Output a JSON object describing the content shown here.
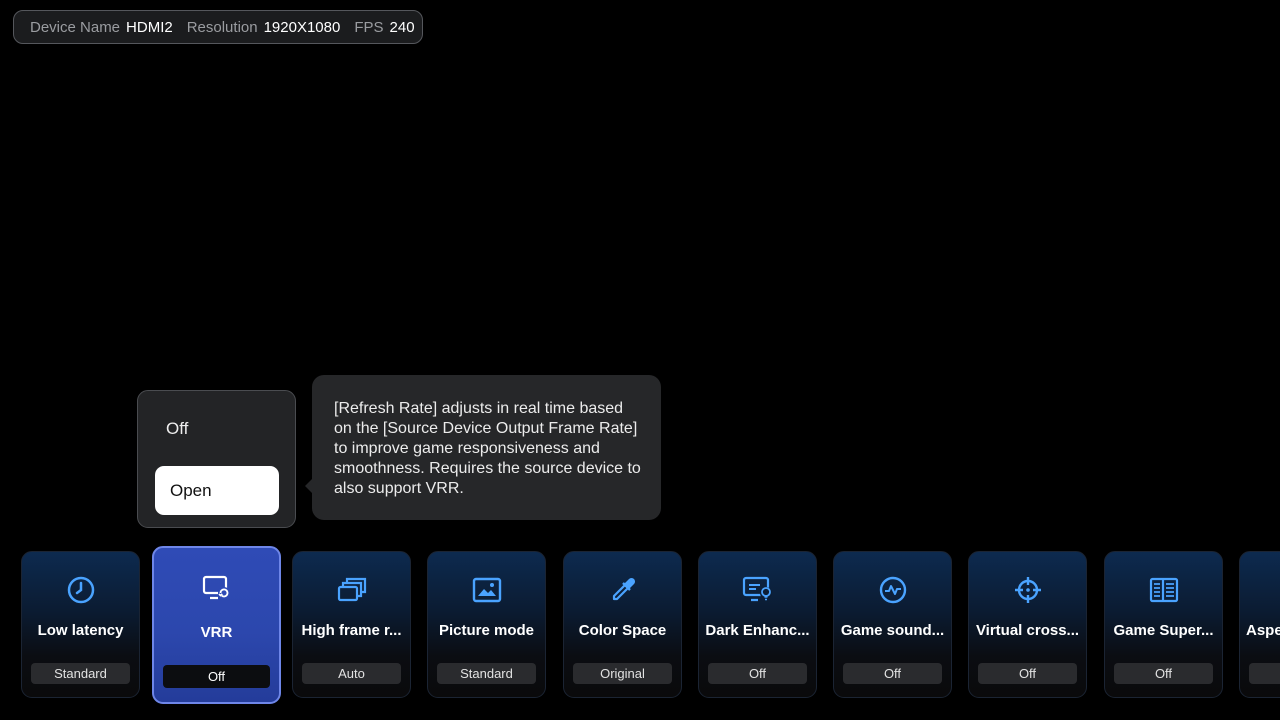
{
  "infobar": {
    "device_name_label": "Device Name",
    "device_name_value": "HDMI2",
    "resolution_label": "Resolution",
    "resolution_value": "1920X1080",
    "fps_label": "FPS",
    "fps_value": "240"
  },
  "dropdown": {
    "options": [
      "Off",
      "Open"
    ],
    "highlighted": "Open"
  },
  "tooltip": {
    "text": "[Refresh Rate] adjusts in real time based on the [Source Device Output Frame Rate] to improve game responsiveness and smoothness. Requires the source device to also support VRR."
  },
  "cards": [
    {
      "title": "Low latency",
      "value": "Standard",
      "icon": "clock-icon"
    },
    {
      "title": "VRR",
      "value": "Off",
      "icon": "monitor-refresh-icon",
      "selected": true
    },
    {
      "title": "High frame r...",
      "value": "Auto",
      "icon": "stacked-frames-icon"
    },
    {
      "title": "Picture mode",
      "value": "Standard",
      "icon": "picture-icon"
    },
    {
      "title": "Color Space",
      "value": "Original",
      "icon": "eyedropper-icon"
    },
    {
      "title": "Dark Enhanc...",
      "value": "Off",
      "icon": "monitor-bulb-icon"
    },
    {
      "title": "Game sound...",
      "value": "Off",
      "icon": "waveform-icon"
    },
    {
      "title": "Virtual cross...",
      "value": "Off",
      "icon": "crosshair-icon"
    },
    {
      "title": "Game Super...",
      "value": "Off",
      "icon": "grid-panel-icon"
    },
    {
      "title": "Aspe",
      "value": "",
      "icon": ""
    }
  ],
  "colors": {
    "accent_icon": "#4aa3ff",
    "selected_card": "#2f4bb6",
    "selected_border": "#6e86e8"
  }
}
